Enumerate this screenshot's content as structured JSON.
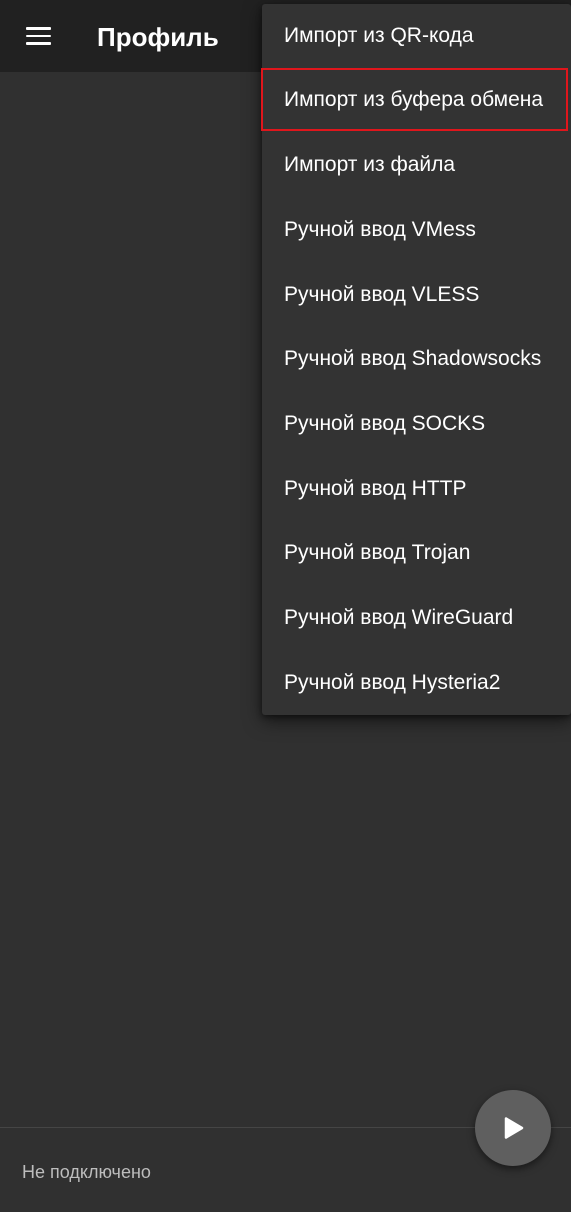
{
  "app_bar": {
    "title": "Профиль",
    "menu_icon": "hamburger-menu-icon"
  },
  "popup_menu": {
    "items": [
      {
        "label": "Импорт из QR-кода"
      },
      {
        "label": "Импорт из буфера обмена",
        "highlighted": true
      },
      {
        "label": "Импорт из файла"
      },
      {
        "label": "Ручной ввод VMess"
      },
      {
        "label": "Ручной ввод VLESS"
      },
      {
        "label": "Ручной ввод Shadowsocks"
      },
      {
        "label": "Ручной ввод SOCKS"
      },
      {
        "label": "Ручной ввод HTTP"
      },
      {
        "label": "Ручной ввод Trojan"
      },
      {
        "label": "Ручной ввод WireGuard"
      },
      {
        "label": "Ручной ввод Hysteria2"
      }
    ],
    "highlight_color": "#e0161c"
  },
  "status_bar": {
    "text": "Не подключено"
  },
  "fab": {
    "icon": "play-icon"
  }
}
